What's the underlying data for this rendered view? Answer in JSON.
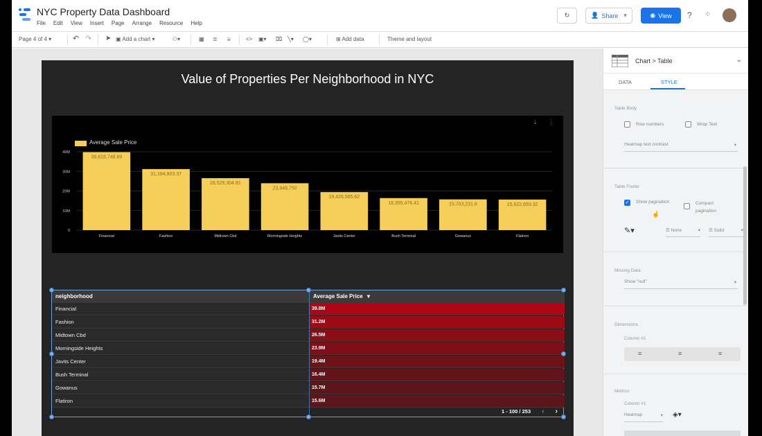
{
  "header": {
    "title": "NYC Property Data Dashboard",
    "menu": [
      "File",
      "Edit",
      "View",
      "Insert",
      "Page",
      "Arrange",
      "Resource",
      "Help"
    ],
    "share_label": "Share",
    "view_label": "View"
  },
  "toolbar": {
    "page_indicator": "Page 4 of 4",
    "add_chart_label": "Add a chart",
    "add_data_label": "Add data",
    "theme_label": "Theme and layout"
  },
  "report": {
    "title": "Value of Properties Per Neighborhood in NYC"
  },
  "chart_data": {
    "type": "bar",
    "title": "",
    "legend": "Average Sale Price",
    "categories": [
      "Financial",
      "Fashion",
      "Midtown Cbd",
      "Morningside Heights",
      "Javits Center",
      "Bush Terminal",
      "Gowanus",
      "Flatiron"
    ],
    "values": [
      39818748.89,
      31184803.37,
      26529304.81,
      23948750,
      19426565.62,
      16355476.41,
      15703231.8,
      15622693.32
    ],
    "data_labels": [
      "39,818,748.89",
      "31,184,803.37",
      "26,529,304.81",
      "23,948,750",
      "19,426,565.62",
      "16,355,476.41",
      "15,703,231.8",
      "15,622,693.32"
    ],
    "y_ticks": [
      "0",
      "10M",
      "20M",
      "30M",
      "40M"
    ],
    "ylim": [
      0,
      40000000
    ]
  },
  "table": {
    "col_neighborhood": "neighborhood",
    "col_price": "Average Sale Price",
    "sort_indicator": "▾",
    "rows": [
      {
        "name": "Financial",
        "value": "39.8M",
        "color": "#b00514"
      },
      {
        "name": "Fashion",
        "value": "31.2M",
        "color": "#9c0a14"
      },
      {
        "name": "Midtown Cbd",
        "value": "26.5M",
        "color": "#8b0d16"
      },
      {
        "name": "Morningside Heights",
        "value": "23.9M",
        "color": "#7e0f17"
      },
      {
        "name": "Javits Center",
        "value": "19.4M",
        "color": "#6e1218"
      },
      {
        "name": "Bush Terminal",
        "value": "16.4M",
        "color": "#62141a"
      },
      {
        "name": "Gowanus",
        "value": "15.7M",
        "color": "#5e151a"
      },
      {
        "name": "Flatiron",
        "value": "15.6M",
        "color": "#5c151a"
      }
    ],
    "pagination": "1 - 100 / 253"
  },
  "panel": {
    "breadcrumb": "Chart > Table",
    "tab_data": "DATA",
    "tab_style": "STYLE",
    "table_body_label": "Table Body",
    "row_numbers_label": "Row numbers",
    "wrap_text_label": "Wrap Text",
    "contrast_label": "Heatmap text contrast",
    "table_footer_label": "Table Footer",
    "show_pagination_label": "Show pagination",
    "compact_pagination_label": "Compact pagination",
    "border_none": "None",
    "border_solid": "Solid",
    "missing_data_label": "Missing Data",
    "missing_data_value": "Show \"null\"",
    "dimensions_label": "Dimensions",
    "column1_label": "Column #1",
    "metrics_label": "Metrics",
    "metric_column_label": "Column #1",
    "heatmap_label": "Heatmap",
    "accent_blue": "#1a73e8"
  }
}
